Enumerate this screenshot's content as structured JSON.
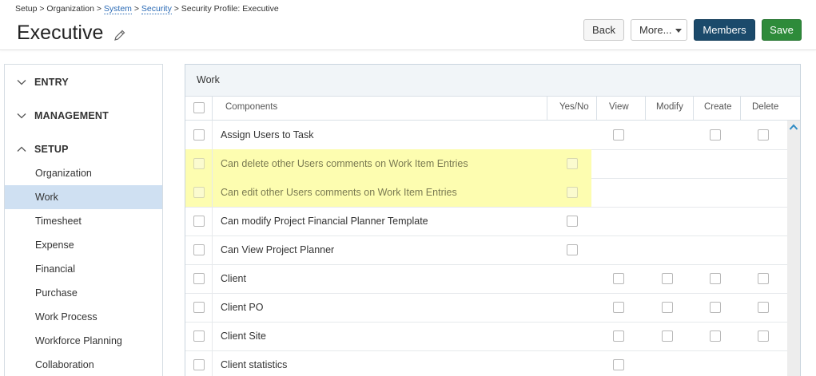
{
  "breadcrumb": {
    "part1": "Setup > Organization > ",
    "system": "System",
    "sep1": " > ",
    "security": "Security",
    "sep2": " > Security Profile: Executive"
  },
  "page_title": "Executive",
  "buttons": {
    "back": "Back",
    "more": "More...",
    "members": "Members",
    "save": "Save"
  },
  "sidebar": {
    "sections": [
      {
        "label": "ENTRY",
        "expanded": false
      },
      {
        "label": "MANAGEMENT",
        "expanded": false
      },
      {
        "label": "SETUP",
        "expanded": true
      }
    ],
    "setup_items": [
      {
        "label": "Organization",
        "active": false
      },
      {
        "label": "Work",
        "active": true
      },
      {
        "label": "Timesheet",
        "active": false
      },
      {
        "label": "Expense",
        "active": false
      },
      {
        "label": "Financial",
        "active": false
      },
      {
        "label": "Purchase",
        "active": false
      },
      {
        "label": "Work Process",
        "active": false
      },
      {
        "label": "Workforce Planning",
        "active": false
      },
      {
        "label": "Collaboration",
        "active": false
      }
    ]
  },
  "panel": {
    "title": "Work",
    "columns": {
      "components": "Components",
      "yes_no": "Yes/No",
      "view": "View",
      "modify": "Modify",
      "create": "Create",
      "delete": "Delete"
    },
    "rows": [
      {
        "label": "Assign Users to Task",
        "highlighted": false,
        "yes_no": false,
        "view": true,
        "modify": false,
        "create": true,
        "delete": true
      },
      {
        "label": "Can delete other Users comments on Work Item Entries",
        "highlighted": true,
        "yes_no": true,
        "view": false,
        "modify": false,
        "create": false,
        "delete": false
      },
      {
        "label": "Can edit other Users comments on Work Item Entries",
        "highlighted": true,
        "yes_no": true,
        "view": false,
        "modify": false,
        "create": false,
        "delete": false
      },
      {
        "label": "Can modify Project Financial Planner Template",
        "highlighted": false,
        "yes_no": true,
        "view": false,
        "modify": false,
        "create": false,
        "delete": false
      },
      {
        "label": "Can View Project Planner",
        "highlighted": false,
        "yes_no": true,
        "view": false,
        "modify": false,
        "create": false,
        "delete": false
      },
      {
        "label": "Client",
        "highlighted": false,
        "yes_no": false,
        "view": true,
        "modify": true,
        "create": true,
        "delete": true
      },
      {
        "label": "Client PO",
        "highlighted": false,
        "yes_no": false,
        "view": true,
        "modify": true,
        "create": true,
        "delete": true
      },
      {
        "label": "Client Site",
        "highlighted": false,
        "yes_no": false,
        "view": true,
        "modify": true,
        "create": true,
        "delete": true
      },
      {
        "label": "Client statistics",
        "highlighted": false,
        "yes_no": false,
        "view": true,
        "modify": false,
        "create": false,
        "delete": false
      }
    ]
  },
  "colors": {
    "link": "#2a6ab5",
    "members_button": "#1b4a6b",
    "save_button": "#2e8b3a",
    "active_nav": "#cfe0f2",
    "highlight": "#fdfdb0"
  },
  "icons": [
    "pencil-icon",
    "chevron-down-icon",
    "chevron-up-icon",
    "caret-down-icon",
    "scroll-up-icon"
  ]
}
